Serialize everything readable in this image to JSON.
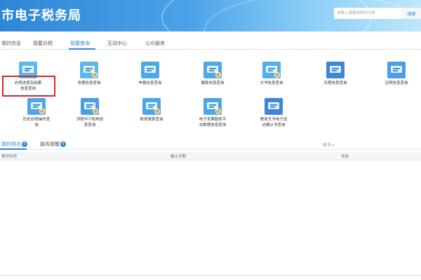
{
  "header": {
    "site_title": "市电子税务局",
    "search_placeholder": "请输入需要搜索的内容",
    "search_button": "搜索"
  },
  "tabs": [
    {
      "label": "我的信息",
      "active": false
    },
    {
      "label": "我要办税",
      "active": false
    },
    {
      "label": "我要查询",
      "active": true
    },
    {
      "label": "互动中心",
      "active": false
    },
    {
      "label": "公众服务",
      "active": false
    }
  ],
  "grid": {
    "row1": [
      {
        "label1": "办税进度及结果",
        "label2": "信息查询",
        "icon": "progress-query-icon",
        "color": "#5fb6ee",
        "highlighted": true
      },
      {
        "label1": "发票信息查询",
        "label2": "",
        "icon": "invoice-query-icon",
        "color": "#5bb8e8"
      },
      {
        "label1": "申报信息查询",
        "label2": "",
        "icon": "declaration-query-icon",
        "color": "#4aaae6"
      },
      {
        "label1": "缴款信息查询",
        "label2": "",
        "icon": "payment-query-icon",
        "color": "#4ea8e6"
      },
      {
        "label1": "文书信息查询",
        "label2": "",
        "icon": "document-query-icon",
        "color": "#55b0e8"
      },
      {
        "label1": "优惠信息查询",
        "label2": "",
        "icon": "preferential-query-icon",
        "color": "#3e86d8"
      },
      {
        "label1": "证明信息查询",
        "label2": "",
        "icon": "certificate-query-icon",
        "color": "#4a9de6"
      }
    ],
    "row2": [
      {
        "label1": "历史办税操作查",
        "label2": "询",
        "icon": "history-query-icon",
        "color": "#4ea6e6"
      },
      {
        "label1": "涉税中介机构信",
        "label2": "息查询",
        "icon": "agency-query-icon",
        "color": "#4a9fe4"
      },
      {
        "label1": "财务报表查询",
        "label2": "",
        "icon": "financial-report-icon",
        "color": "#4aa6e6"
      },
      {
        "label1": "电子发票服务平",
        "label2": "台数据信息查询",
        "icon": "e-invoice-platform-icon",
        "color": "#4aa6e6"
      },
      {
        "label1": "税务文书电子送",
        "label2": "达确认书查询",
        "icon": "tax-document-delivery-icon",
        "color": "#3e86d8"
      }
    ]
  },
  "sub_tabs": {
    "todo_label": "我的待办",
    "todo_count": "0",
    "reminder_label": "服务提醒",
    "reminder_count": "0",
    "more_label": "更多>"
  },
  "table": {
    "columns": [
      "事项名称",
      "截止日期",
      "状态"
    ]
  }
}
